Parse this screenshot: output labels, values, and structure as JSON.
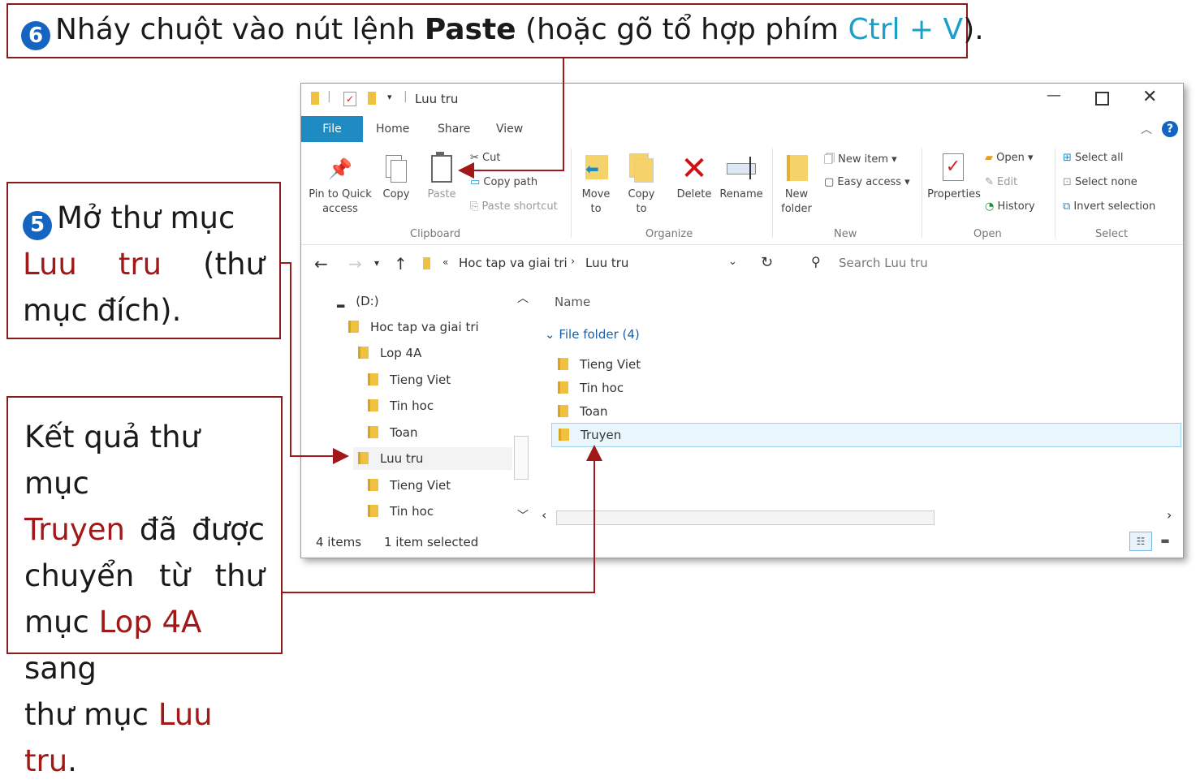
{
  "callouts": {
    "step6": {
      "number": "6",
      "pre": "Nháy chuột vào nút lệnh ",
      "bold": "Paste",
      "mid": " (hoặc gõ tổ hợp phím ",
      "keys": "Ctrl + V",
      "post": ")."
    },
    "step5": {
      "number": "5",
      "line1": "Mở thư mục",
      "w1": "Luu",
      "w2": "tru",
      "w3": "(thư",
      "line3": "mục đích)."
    },
    "result": {
      "l1": "Kết quả thư mục",
      "t1": "Truyen",
      "t2": "đã",
      "t3": "được",
      "l3a": "chuyển",
      "l3b": "từ",
      "l3c": "thư",
      "l4a": "mục ",
      "l4b": "Lop 4A",
      "l4c": " sang",
      "l5a": "thư mục ",
      "l5b": "Luu tru",
      "l5c": "."
    }
  },
  "explorer": {
    "title": "Luu tru",
    "tabs": {
      "file": "File",
      "home": "Home",
      "share": "Share",
      "view": "View"
    },
    "ribbon": {
      "pin": "Pin to Quick access",
      "copy": "Copy",
      "paste": "Paste",
      "cut": "Cut",
      "copy_path": "Copy path",
      "paste_shortcut": "Paste shortcut",
      "move_to": "Move to",
      "copy_to": "Copy to",
      "delete": "Delete",
      "rename": "Rename",
      "new_folder": "New folder",
      "new_item": "New item",
      "easy_access": "Easy access",
      "properties": "Properties",
      "open": "Open",
      "edit": "Edit",
      "history": "History",
      "select_all": "Select all",
      "select_none": "Select none",
      "invert_selection": "Invert selection",
      "groups": {
        "clipboard": "Clipboard",
        "organize": "Organize",
        "new": "New",
        "open": "Open",
        "select": "Select"
      }
    },
    "address": {
      "crumb1": "Hoc tap va giai tri",
      "crumb2": "Luu tru",
      "search_placeholder": "Search Luu tru"
    },
    "nav_tree": [
      "(D:)",
      "Hoc tap va giai tri",
      "Lop 4A",
      "Tieng Viet",
      "Tin hoc",
      "Toan",
      "Luu tru",
      "Tieng Viet",
      "Tin hoc"
    ],
    "content": {
      "column_name": "Name",
      "group_label": "File folder (4)",
      "items": [
        "Tieng Viet",
        "Tin hoc",
        "Toan",
        "Truyen"
      ],
      "selected": "Truyen"
    },
    "status": {
      "count": "4 items",
      "selection": "1 item selected"
    }
  },
  "colors": {
    "accent": "#1e8bc3",
    "callout_border": "#8b1a1a",
    "highlight_red": "#a01818",
    "keys_teal": "#1aa0c8",
    "badge_blue": "#1565c0"
  }
}
